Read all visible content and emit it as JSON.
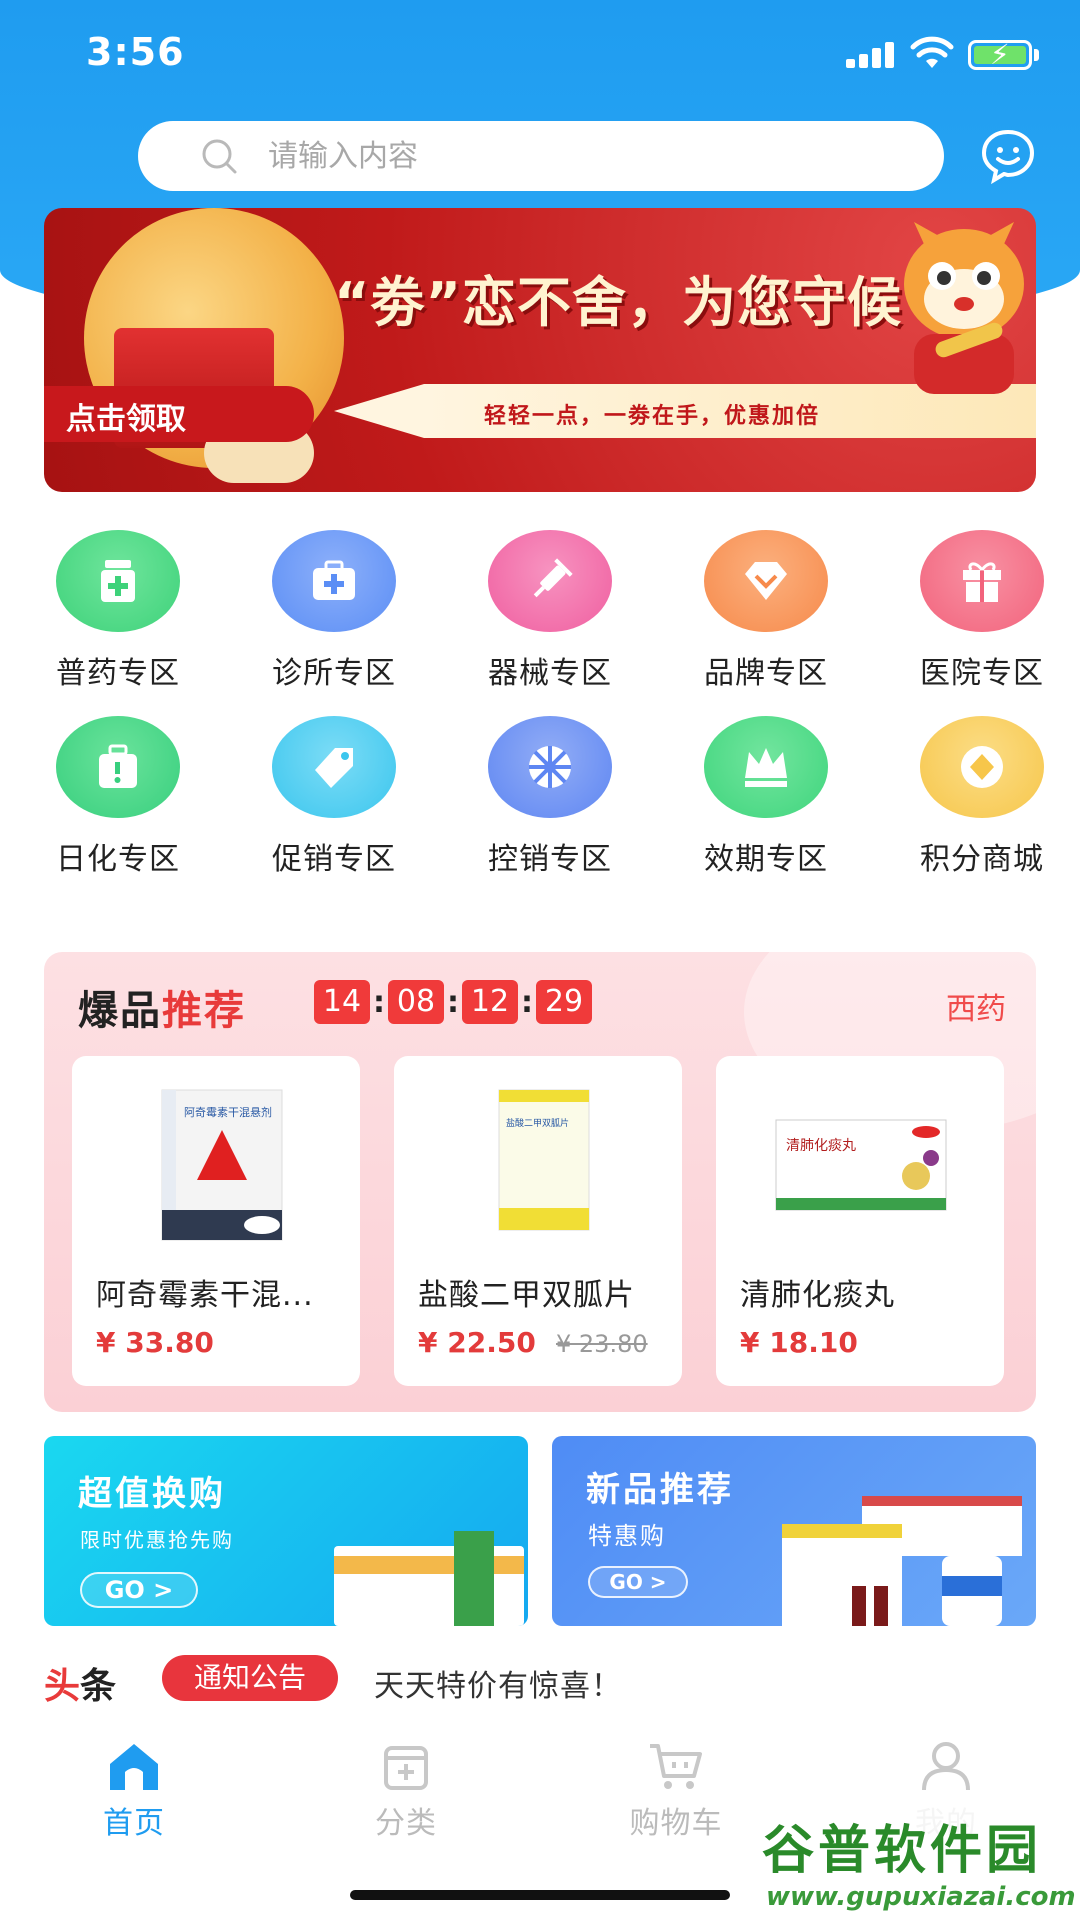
{
  "status_bar": {
    "time": "3:56"
  },
  "search": {
    "placeholder": "请输入内容"
  },
  "banner": {
    "title": "“劵”恋不舍，为您守候",
    "subtitle": "轻轻一点，一劵在手，优惠加倍",
    "cta": "点击领取",
    "active_index": 1,
    "count": 3
  },
  "categories": [
    {
      "label": "普药专区",
      "icon": "medicine-bottle-icon",
      "color": "#3ed27a"
    },
    {
      "label": "诊所专区",
      "icon": "first-aid-kit-icon",
      "color": "#5b8ef5"
    },
    {
      "label": "器械专区",
      "icon": "syringe-icon",
      "color": "#f05fa0"
    },
    {
      "label": "品牌专区",
      "icon": "diamond-icon",
      "color": "#f78a4b"
    },
    {
      "label": "医院专区",
      "icon": "gift-icon",
      "color": "#f2637c"
    },
    {
      "label": "日化专区",
      "icon": "bag-icon",
      "color": "#38cf7e"
    },
    {
      "label": "促销专区",
      "icon": "tag-icon",
      "color": "#3bc6ee"
    },
    {
      "label": "控销专区",
      "icon": "wheel-icon",
      "color": "#5e86f2"
    },
    {
      "label": "效期专区",
      "icon": "crown-icon",
      "color": "#3fd57d"
    },
    {
      "label": "积分商城",
      "icon": "coin-icon",
      "color": "#f7c64a"
    }
  ],
  "hot": {
    "title_a": "爆品",
    "title_b": "推",
    "title_c": "荐",
    "countdown": [
      "14",
      "08",
      "12",
      "29"
    ],
    "category": "西药",
    "products": [
      {
        "name": "阿奇霉素干混...",
        "price": "¥ 33.80",
        "old_price": ""
      },
      {
        "name": "盐酸二甲双胍片",
        "price": "¥ 22.50",
        "old_price": "¥ 23.80"
      },
      {
        "name": "清肺化痰丸",
        "price": "¥ 18.10",
        "old_price": ""
      }
    ]
  },
  "promos": [
    {
      "title": "超值换购",
      "subtitle": "限时优惠抢先购",
      "button": "GO >",
      "color_a": "#1ad8f0",
      "color_b": "#15a8f0"
    },
    {
      "title": "新品推荐",
      "subtitle": "特惠购",
      "button": "GO >",
      "color_a": "#4f8cf5",
      "color_b": "#6aa8f8"
    }
  ],
  "headline": {
    "tag_a": "头",
    "tag_b": "条",
    "badge": "通知公告",
    "text": "天天特价有惊喜！"
  },
  "tabbar": [
    {
      "label": "首页",
      "icon": "home-icon",
      "active": true
    },
    {
      "label": "分类",
      "icon": "category-icon",
      "active": false
    },
    {
      "label": "购物车",
      "icon": "cart-icon",
      "active": false
    },
    {
      "label": "我的",
      "icon": "user-icon",
      "active": false
    }
  ],
  "watermark": {
    "title": "谷普软件园",
    "url": "www.gupuxiazai.com"
  },
  "colors": {
    "accent": "#1f9cf0",
    "price": "#e33b3b",
    "header": "#1f9cf0"
  }
}
